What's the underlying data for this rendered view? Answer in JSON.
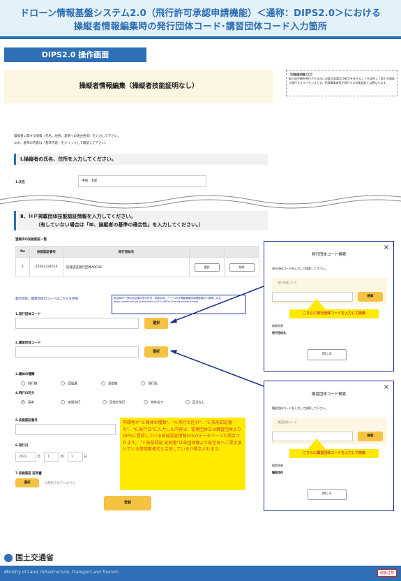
{
  "header": {
    "line1": "ドローン情報基盤システム2.0（飛行許可承認申請機能）＜通称：DIPS2.0＞における",
    "line2": "操縦者情報編集時の発行団体コード･講習団体コード入力箇所"
  },
  "tag": "DIPS2.0 操作画面",
  "form_title": "操縦者情報編集（操縦者技能証明なし）",
  "note_title": "【技能証明書とは】",
  "note_body": "無人航空機を飛行させるのに必要な知識及び能力を有することを証明して国土交通省が発行するライセンスです。民間事業者等が発行する技能認証とは異なります。",
  "intro1": "操縦者に関する情報（氏名、住所、基準への適合性等）を入力して下さい。",
  "intro2": "なお、基準の内容は「基準内容」をクリックして確認して下さい。",
  "section1": "Ⅰ.操縦者の氏名、住所を入力してください。",
  "name_label": "1.氏名",
  "name_value": "申請　太郎",
  "section2_line1": "Ⅱ、ＨＰ掲載団体技能認証情報を入力してください。",
  "section2_line2": "（有していない場合は「Ⅲ、操縦者の基準の適合性」を入力してください。）",
  "list_title": "登録済の技能認証一覧",
  "table": {
    "headers": [
      "No",
      "技能認証番号",
      "発行団体名"
    ],
    "row": [
      "1",
      "ZZ041234510",
      "技能認証発行団体ABCDE"
    ],
    "select": "選択",
    "delete": "削除"
  },
  "link_text": "発行団体、講習団体のコードはこちらを参照",
  "callout_blue": "航空局HP「無人航空機の飛行許可・承認手続」ページのHP掲載講習団体関連項目へ遷移します。 https://www.mlit.go.jp/koku/koku_fr10_000041.html#private-school",
  "field1": "1.発行団体コード",
  "field2": "2.講習団体コード",
  "select_btn": "選択",
  "field3": "3.機体の種類",
  "kinds": [
    "飛行機",
    "回転翼",
    "滑空機",
    "飛行船"
  ],
  "field4": "4.飛行の区分",
  "divisions": [
    "基本",
    "夜間飛行",
    "目視外飛行",
    "物件投下",
    "区分なし"
  ],
  "field5": "5.技能認証番号",
  "field6": "6.発行日",
  "date": {
    "year": "2022",
    "y": "年",
    "month": "1",
    "m": "月",
    "day": "1",
    "d": "日"
  },
  "field7": "7.技能認証 証明書",
  "file_btn": "選択",
  "file_note": "※選択されていません",
  "submit": "登録",
  "yellow_note": "申請者が\"3.機体の種類\"、\"4.飛行の区分\"、\"5.技能認証番号\"、\"6.発行日\"に入力した内容は、管理団体又は講習団体よりDIPSに登録している技能認証情報(CSV)データベースと照合されます。 \"7.技能認証 証明書\"は各団体様より航空局へご提示頂いている証明書様式と合致しているか照合されます。",
  "modal1": {
    "title": "発行団体コード検索",
    "hint": "発行団体コードを入力して検索して下さい。",
    "placeholder": "発行団体コード",
    "search": "検索",
    "callout": "こちらに発行団体コードを入力して検索",
    "result_label": "検索結果",
    "result_col": "発行団体名",
    "close": "閉じる"
  },
  "modal2": {
    "title": "講習団体コード検索",
    "hint": "講習団体コードを入力して検索して下さい。",
    "placeholder": "講習団体コード",
    "search": "検索",
    "callout": "こちらに講習団体コードを入力して検索",
    "result_label": "検索結果",
    "result_col": "講習団体",
    "close": "閉じる"
  },
  "footer": {
    "logo": "国土交通省",
    "english": "Ministry of Land, Infrastructure, Transport and Tourism",
    "badge": "取扱注意"
  },
  "colors": {
    "brand": "#2e6fb5",
    "modal_border": "#1e2f8e",
    "callout": "#ffea00",
    "button": "#f5c242"
  }
}
